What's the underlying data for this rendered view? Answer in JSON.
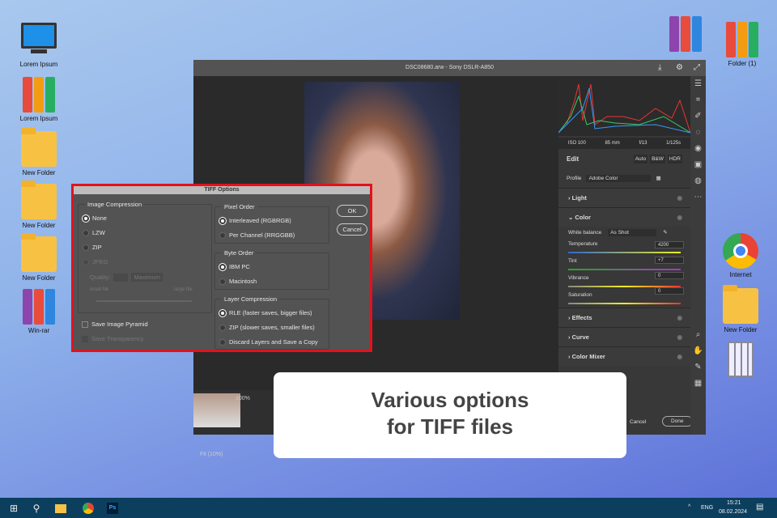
{
  "desktop": {
    "left": [
      {
        "label": "Lorem Ipsum",
        "icon": "computer-icon"
      },
      {
        "label": "Lorem Ipsum",
        "icon": "binders-icon"
      },
      {
        "label": "New Folder",
        "icon": "folder-icon"
      },
      {
        "label": "New Folder",
        "icon": "folder-icon"
      },
      {
        "label": "New Folder",
        "icon": "folder-icon"
      },
      {
        "label": "Win-rar",
        "icon": "winrar-icon"
      }
    ],
    "right": [
      {
        "label": "Folder (1)",
        "icon": "binders-icon"
      },
      {
        "label": "Internet",
        "icon": "chrome-icon"
      },
      {
        "label": "New Folder",
        "icon": "folder-icon"
      }
    ]
  },
  "window": {
    "title": "DSC08680.arw  -  Sony DSLR-A850"
  },
  "camera": {
    "iso": "ISO 100",
    "focal": "85 mm",
    "aperture": "f/13",
    "shutter": "1/125s"
  },
  "edit": {
    "title": "Edit",
    "auto": "Auto",
    "bw": "B&W",
    "hdr": "HDR",
    "profile_label": "Profile",
    "profile": "Adobe Color"
  },
  "sections": {
    "light": "Light",
    "color": "Color",
    "effects": "Effects",
    "curve": "Curve",
    "mixer": "Color Mixer"
  },
  "color": {
    "wb_label": "White balance",
    "wb": "As Shot",
    "temp_label": "Temperature",
    "temp": "4200",
    "tint_label": "Tint",
    "tint": "+7",
    "vib_label": "Vibrance",
    "vib": "0",
    "sat_label": "Saturation",
    "sat": "0"
  },
  "bottom": {
    "fit": "Fit (10%)",
    "zoom": "100%",
    "cancel": "Cancel",
    "done": "Done"
  },
  "dialog": {
    "title": "TIFF Options",
    "compression": "Image Compression",
    "none": "None",
    "lzw": "LZW",
    "zip": "ZIP",
    "jpeg": "JPEG",
    "quality": "Quality:",
    "quality_sel": "Maximum",
    "small": "small file",
    "large": "large file",
    "pyramid": "Save Image Pyramid",
    "transparency": "Save Transparency",
    "pixel_order": "Pixel Order",
    "interleaved": "Interleaved (RGBRGB)",
    "per_channel": "Per Channel (RRGGBB)",
    "byte_order": "Byte Order",
    "ibm": "IBM PC",
    "mac": "Macintosh",
    "layer_comp": "Layer Compression",
    "rle": "RLE (faster saves, bigger files)",
    "lzip": "ZIP (slower saves, smaller files)",
    "discard": "Discard Layers and Save a Copy",
    "ok": "OK",
    "cancel": "Cancel"
  },
  "caption": {
    "line1": "Various options",
    "line2": "for TIFF files"
  },
  "taskbar": {
    "lang": "ENG",
    "time": "15:21",
    "date": "08.02.2024"
  }
}
